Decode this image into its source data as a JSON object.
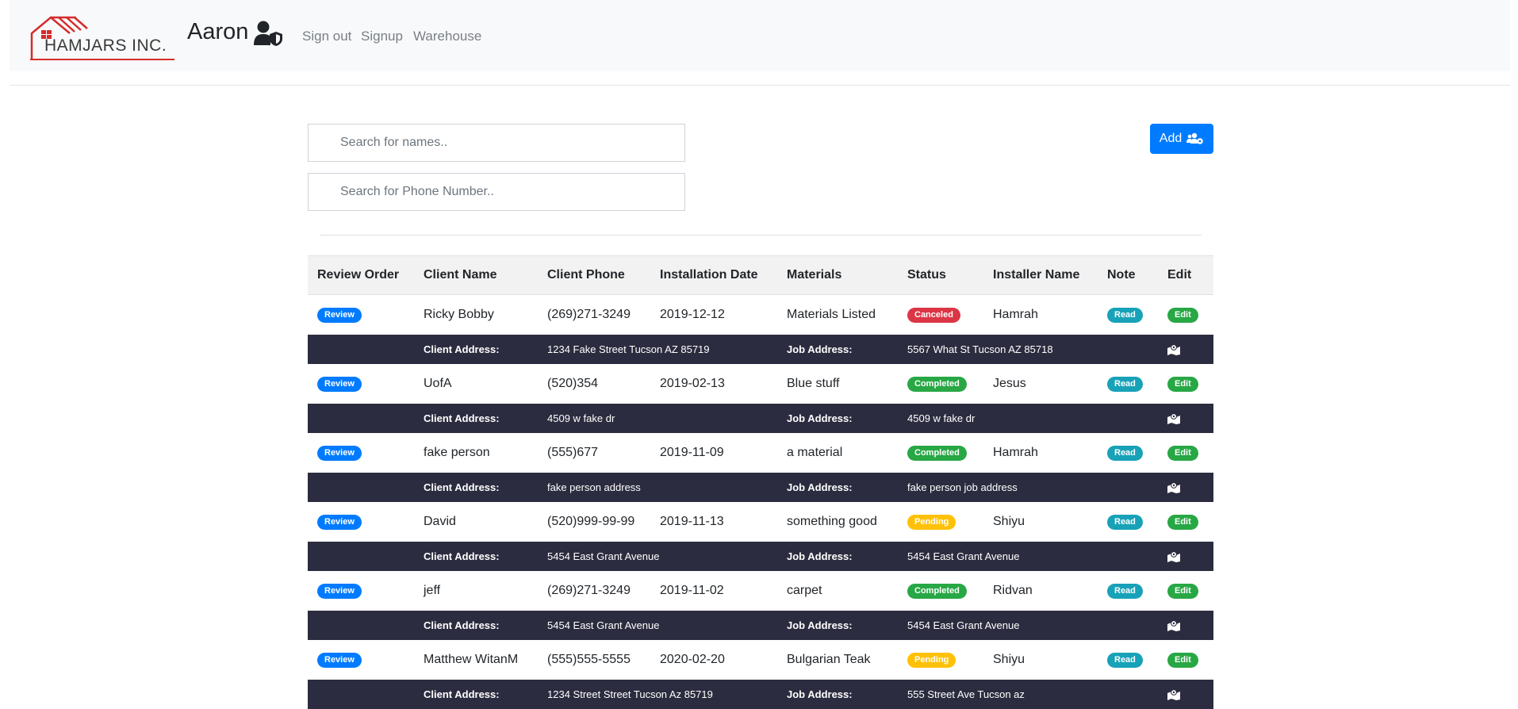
{
  "app": {
    "logo_text": "HAMJARS INC.",
    "username": "Aaron",
    "nav_links": [
      "Sign out",
      "Signup",
      "Warehouse"
    ]
  },
  "search": {
    "names_placeholder": "Search for names..",
    "phone_placeholder": "Search for Phone Number.."
  },
  "add_button": {
    "label": "Add",
    "icon": "users-cog-icon"
  },
  "table": {
    "headers": [
      "Review Order",
      "Client Name",
      "Client Phone",
      "Installation Date",
      "Materials",
      "Status",
      "Installer Name",
      "Note",
      "Edit"
    ],
    "review_label": "Review",
    "read_label": "Read",
    "edit_label": "Edit",
    "client_address_label": "Client Address:",
    "job_address_label": "Job Address:",
    "rows": [
      {
        "name": "Ricky Bobby",
        "phone": "(269)271-3249",
        "date": "2019-12-12",
        "materials": "Materials Listed",
        "status": "Canceled",
        "installer": "Hamrah",
        "client_address": "1234 Fake Street Tucson AZ 85719",
        "job_address": "5567 What St Tucson AZ 85718"
      },
      {
        "name": "UofA",
        "phone": "(520)354",
        "date": "2019-02-13",
        "materials": "Blue stuff",
        "status": "Completed",
        "installer": "Jesus",
        "client_address": "4509 w fake dr",
        "job_address": "4509 w fake dr"
      },
      {
        "name": "fake person",
        "phone": "(555)677",
        "date": "2019-11-09",
        "materials": "a material",
        "status": "Completed",
        "installer": "Hamrah",
        "client_address": "fake person address",
        "job_address": "fake person job address"
      },
      {
        "name": "David",
        "phone": "(520)999-99-99",
        "date": "2019-11-13",
        "materials": "something good",
        "status": "Pending",
        "installer": "Shiyu",
        "client_address": "5454 East Grant Avenue",
        "job_address": "5454 East Grant Avenue"
      },
      {
        "name": "jeff",
        "phone": "(269)271-3249",
        "date": "2019-11-02",
        "materials": "carpet",
        "status": "Completed",
        "installer": "Ridvan",
        "client_address": "5454 East Grant Avenue",
        "job_address": "5454 East Grant Avenue"
      },
      {
        "name": "Matthew WitanM",
        "phone": "(555)555-5555",
        "date": "2020-02-20",
        "materials": "Bulgarian Teak",
        "status": "Pending",
        "installer": "Shiyu",
        "client_address": "1234 Street Street Tucson Az 85719",
        "job_address": "555 Street Ave Tucson az"
      }
    ]
  },
  "colors": {
    "primary": "#007bff",
    "info": "#17a2b8",
    "success": "#28a745",
    "danger": "#dc3545",
    "warning": "#ffc107",
    "address_row_bg": "#2c2c40"
  }
}
